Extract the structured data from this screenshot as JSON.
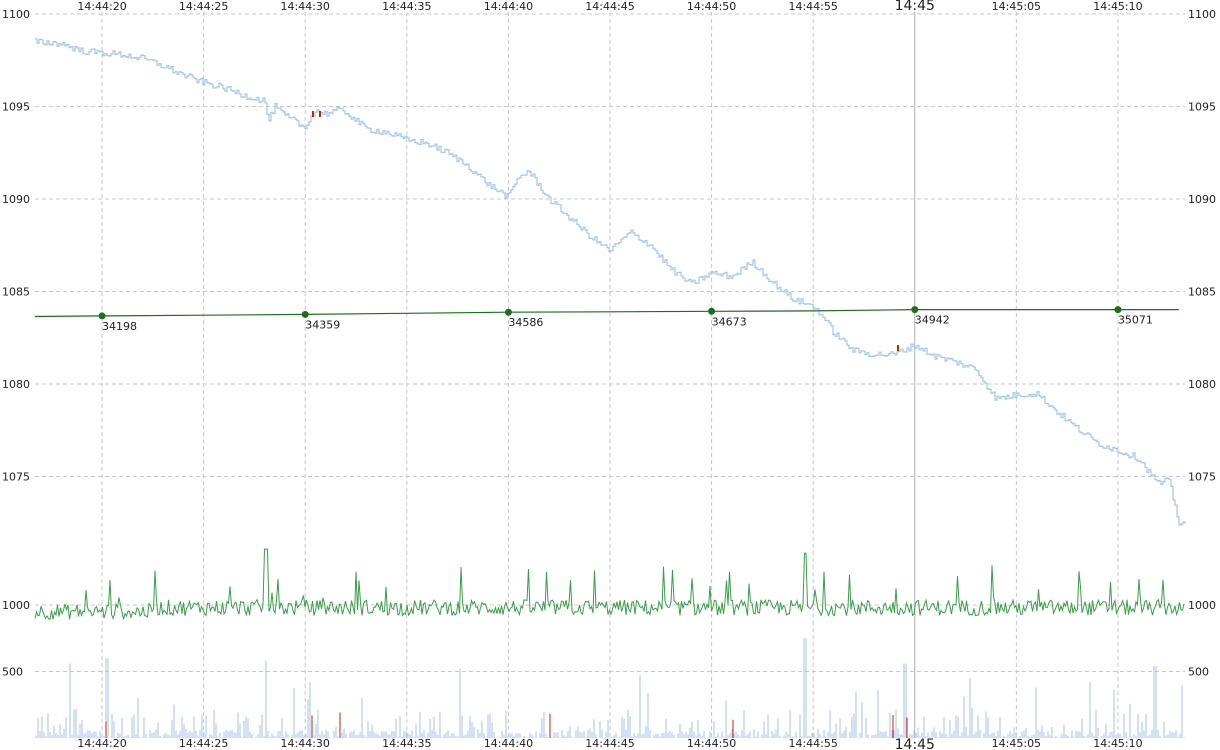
{
  "chart_data": {
    "type": "line",
    "x_ticks": [
      "14:44:20",
      "14:44:25",
      "14:44:30",
      "14:44:35",
      "14:44:40",
      "14:44:45",
      "14:44:50",
      "14:44:55",
      "14:45",
      "14:45:05",
      "14:45:10"
    ],
    "x_tick_seconds": [
      20,
      25,
      30,
      35,
      40,
      45,
      50,
      55,
      60,
      65,
      70
    ],
    "x_range_seconds": [
      16.7,
      73.3
    ],
    "price_panel": {
      "ylim": [
        1070,
        1100
      ],
      "y_ticks": [
        "1100",
        "1095",
        "1090",
        "1085",
        "1080",
        "1075"
      ],
      "y_tick_values": [
        1100,
        1095,
        1090,
        1085,
        1080,
        1075
      ],
      "price_series": {
        "color": "#a4c6ea",
        "x": [
          16.7,
          18,
          18.5,
          19,
          20,
          21,
          22,
          23,
          24,
          25,
          26,
          27,
          28,
          28.2,
          28.5,
          29,
          29.5,
          30,
          30.2,
          30.6,
          31,
          31.5,
          32,
          33,
          34,
          35,
          36,
          37,
          38,
          39,
          40,
          40.5,
          41,
          42,
          43,
          44,
          45,
          46,
          47,
          48,
          49,
          50,
          51,
          52,
          53,
          54,
          55,
          55.3,
          56,
          57,
          58,
          59,
          60,
          61,
          62,
          63,
          64,
          65,
          66,
          67,
          68,
          69,
          70,
          71,
          72,
          72.5,
          73
        ],
        "y": [
          1098.5,
          1098.4,
          1098.2,
          1098,
          1097.9,
          1097.8,
          1097.6,
          1097.2,
          1096.7,
          1096.3,
          1096,
          1095.6,
          1095.3,
          1094.2,
          1095,
          1094.5,
          1094.2,
          1093.8,
          1094.4,
          1094.8,
          1094.6,
          1094.8,
          1094.7,
          1093.8,
          1093.6,
          1093.2,
          1093,
          1092.5,
          1091.8,
          1090.8,
          1090.1,
          1091.2,
          1091.5,
          1090,
          1089,
          1088,
          1087.2,
          1088.2,
          1087.5,
          1086.2,
          1085.4,
          1086,
          1085.8,
          1086.6,
          1085.5,
          1084.6,
          1084.2,
          1083.9,
          1082.8,
          1081.8,
          1081.6,
          1081.6,
          1082.1,
          1081.5,
          1081.2,
          1080.8,
          1079.2,
          1079.4,
          1079.5,
          1078.5,
          1077.6,
          1076.8,
          1076.4,
          1076,
          1074.6,
          1074.8,
          1072.5
        ]
      },
      "session_line": {
        "color": "#1e6e1e",
        "x": [
          16.7,
          20,
          25,
          30,
          35,
          40,
          45,
          50,
          55,
          60,
          65,
          70,
          73
        ],
        "y": [
          1083.65,
          1083.68,
          1083.72,
          1083.76,
          1083.82,
          1083.88,
          1083.9,
          1083.93,
          1083.95,
          1084.02,
          1084.02,
          1084.02,
          1084.02
        ],
        "markers": [
          {
            "x": 20,
            "label": "34198"
          },
          {
            "x": 30,
            "label": "34359"
          },
          {
            "x": 40,
            "label": "34586"
          },
          {
            "x": 50,
            "label": "34673"
          },
          {
            "x": 60,
            "label": "34942"
          },
          {
            "x": 70,
            "label": "35071"
          }
        ]
      }
    },
    "volume_panel": {
      "y_ticks": [
        "1000",
        "500"
      ],
      "y_tick_values": [
        1000,
        500
      ],
      "green_series_color": "#3a9e4a",
      "bar_color": "#a4c6ea",
      "highlight_color": "#cc2200"
    },
    "grid": true
  }
}
